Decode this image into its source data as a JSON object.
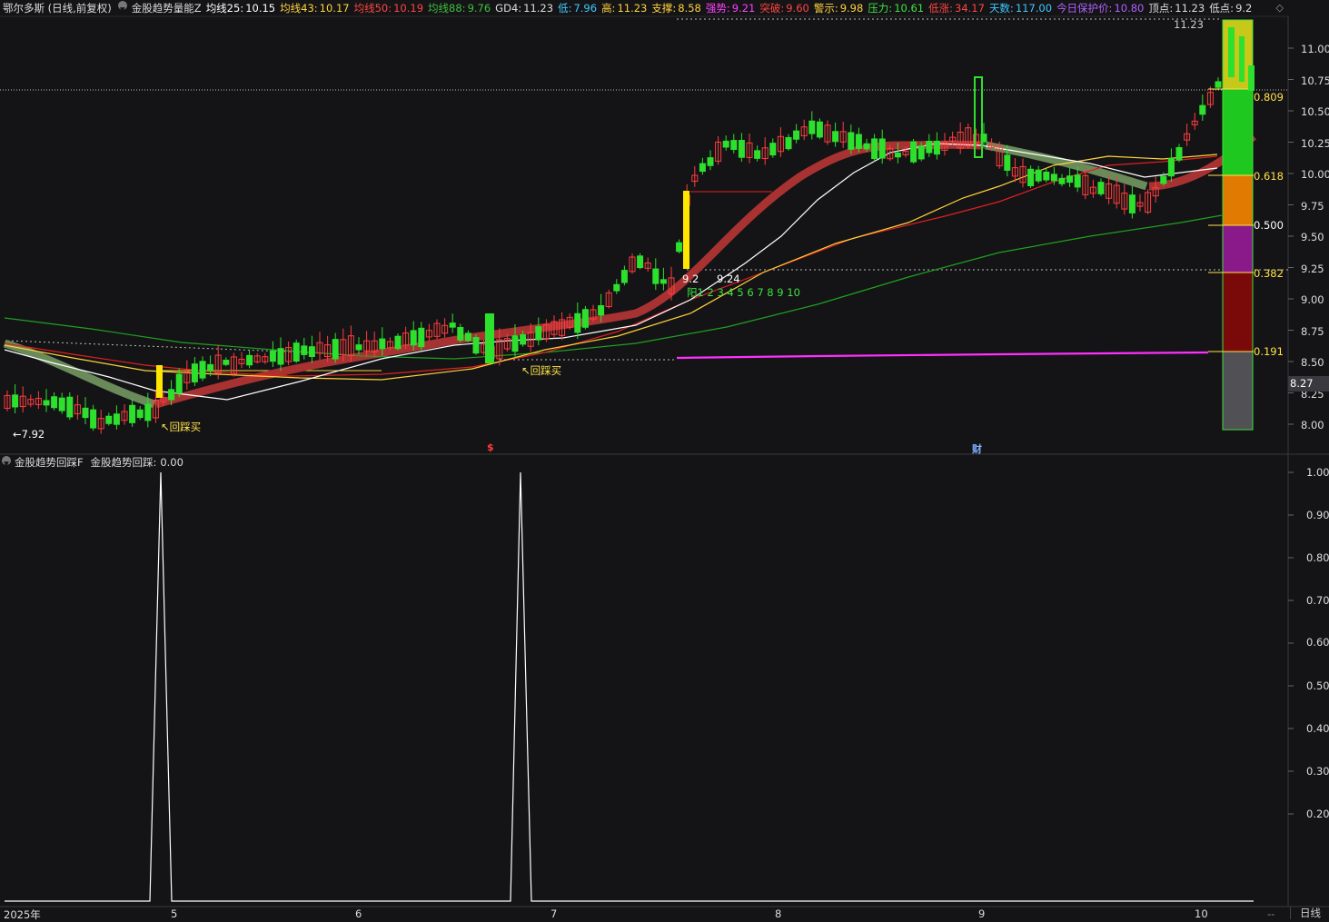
{
  "header": {
    "stock_title": "鄂尔多斯 (日线,前复权)",
    "indicator_name": "金股趋势量能Z",
    "fields": [
      {
        "label": "均线25:",
        "value": "10.15",
        "color": "#ffffff"
      },
      {
        "label": "均线43:",
        "value": "10.17",
        "color": "#ffd23c"
      },
      {
        "label": "均线50:",
        "value": "10.19",
        "color": "#ff4444"
      },
      {
        "label": "均线88:",
        "value": "9.76",
        "color": "#3fbf3f"
      },
      {
        "label": "GD4:",
        "value": "11.23",
        "color": "#dddddd"
      },
      {
        "label": "低:",
        "value": "7.96",
        "color": "#40c8ff"
      },
      {
        "label": "高:",
        "value": "11.23",
        "color": "#ffd23c"
      },
      {
        "label": "支撑:",
        "value": "8.58",
        "color": "#ffd23c"
      },
      {
        "label": "强势:",
        "value": "9.21",
        "color": "#ff40ff"
      },
      {
        "label": "突破:",
        "value": "9.60",
        "color": "#ff4444"
      },
      {
        "label": "警示:",
        "value": "9.98",
        "color": "#ffd23c"
      },
      {
        "label": "压力:",
        "value": "10.61",
        "color": "#3fe03f"
      },
      {
        "label": "低涨:",
        "value": "34.17",
        "color": "#ff4444"
      },
      {
        "label": "天数:",
        "value": "117.00",
        "color": "#40c8ff"
      },
      {
        "label": "今日保护价:",
        "value": "10.80",
        "color": "#b060ff"
      },
      {
        "label": "顶点:",
        "value": "11.23",
        "color": "#dddddd"
      },
      {
        "label": "低点:",
        "value": "9.2",
        "color": "#dddddd"
      }
    ],
    "end_icon": "◇"
  },
  "sub_header": {
    "indicator_name": "金股趋势回踩F",
    "field_label": "金股趋势回踩:",
    "field_value": "0.00"
  },
  "price_axis": [
    "11.00",
    "10.75",
    "10.50",
    "10.25",
    "10.00",
    "9.75",
    "9.50",
    "9.25",
    "9.00",
    "8.75",
    "8.50",
    "8.25",
    "8.00"
  ],
  "current_price_tag": "8.27",
  "sub_axis": [
    "1.00",
    "0.90",
    "0.80",
    "0.70",
    "0.60",
    "0.50",
    "0.40",
    "0.30",
    "0.20"
  ],
  "x_axis": [
    "2025年",
    "5",
    "6",
    "7",
    "8",
    "9",
    "10"
  ],
  "period_button": "日线",
  "scroll_dashes": "--",
  "fib_levels": [
    "0.809",
    "0.618",
    "0.500",
    "0.382",
    "0.191"
  ],
  "annotations": {
    "low_marker": "←7.92",
    "high_marker": "11.23",
    "buy_signal_1": "↖回踩买",
    "buy_signal_2": "↖回踩买",
    "level_left": "9.2",
    "level_right": "9.24",
    "yang_count": "阳1 2 3 4 5 6 7 8 9 10",
    "marker_s": "$",
    "marker_cai": "财"
  },
  "colors": {
    "background": "#141416",
    "up_candle": "#ff3d3d",
    "down_candle": "#2de02d",
    "ma25": "#ffffff",
    "ma43": "#ffd23c",
    "ma50": "#e02020",
    "ma88": "#20a020",
    "support_line": "#ff30ff"
  }
}
